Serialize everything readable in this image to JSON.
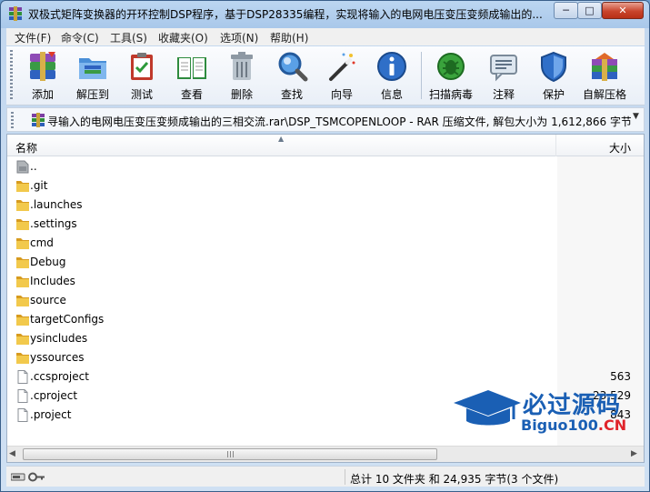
{
  "window": {
    "title": "双极式矩阵变换器的开环控制DSP程序，基于DSP28335编程，实现将输入的电网电压变压变频成输出的...",
    "controls": {
      "minimize": "─",
      "maximize": "□",
      "close": "✕"
    }
  },
  "menu": [
    "文件(F)",
    "命令(C)",
    "工具(S)",
    "收藏夹(O)",
    "选项(N)",
    "帮助(H)"
  ],
  "toolbar": [
    {
      "label": "添加",
      "icon": "add-archive-icon"
    },
    {
      "label": "解压到",
      "icon": "extract-to-folder-icon"
    },
    {
      "label": "测试",
      "icon": "test-clipboard-icon"
    },
    {
      "label": "查看",
      "icon": "view-book-icon"
    },
    {
      "label": "删除",
      "icon": "delete-trash-icon"
    },
    {
      "label": "查找",
      "icon": "find-magnifier-icon"
    },
    {
      "label": "向导",
      "icon": "wizard-wand-icon"
    },
    {
      "label": "信息",
      "icon": "info-icon"
    },
    {
      "label": "扫描病毒",
      "icon": "virus-scan-icon"
    },
    {
      "label": "注释",
      "icon": "comment-icon"
    },
    {
      "label": "保护",
      "icon": "protect-shield-icon"
    },
    {
      "label": "自解压格",
      "icon": "sfx-archive-icon"
    }
  ],
  "address": {
    "path": "寻输入的电网电压变压变频成输出的三相交流.rar\\DSP_TSMCOPENLOOP - RAR 压缩文件, 解包大小为 1,612,866 字节"
  },
  "columns": {
    "name": "名称",
    "size": "大小"
  },
  "files": [
    {
      "name": "..",
      "type": "parent",
      "size": ""
    },
    {
      "name": ".git",
      "type": "folder",
      "size": ""
    },
    {
      "name": ".launches",
      "type": "folder",
      "size": ""
    },
    {
      "name": ".settings",
      "type": "folder",
      "size": ""
    },
    {
      "name": "cmd",
      "type": "folder",
      "size": ""
    },
    {
      "name": "Debug",
      "type": "folder",
      "size": ""
    },
    {
      "name": "Includes",
      "type": "folder",
      "size": ""
    },
    {
      "name": "source",
      "type": "folder",
      "size": ""
    },
    {
      "name": "targetConfigs",
      "type": "folder",
      "size": ""
    },
    {
      "name": "ysincludes",
      "type": "folder",
      "size": ""
    },
    {
      "name": "yssources",
      "type": "folder",
      "size": ""
    },
    {
      "name": ".ccsproject",
      "type": "file",
      "size": "563"
    },
    {
      "name": ".cproject",
      "type": "file",
      "size": "23,529"
    },
    {
      "name": ".project",
      "type": "file",
      "size": "843"
    }
  ],
  "status": {
    "summary": "总计 10 文件夹 和 24,935 字节(3 个文件)"
  },
  "watermark": {
    "title": "必过源码",
    "site": "Biguo100",
    "tld": ".CN"
  },
  "colors": {
    "folder": "#e8b73c",
    "accent": "#1a5fb4",
    "close": "#c9452c"
  }
}
